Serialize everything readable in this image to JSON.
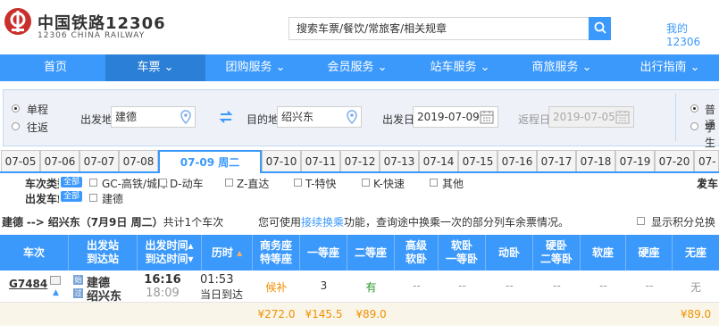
{
  "header": {
    "logo_cn": "中国铁路12306",
    "logo_en": "12306 CHINA RAILWAY",
    "search_placeholder": "搜索车票/餐饮/常旅客/相关规章",
    "my_link": "我的12306"
  },
  "nav": [
    "首页",
    "车票",
    "团购服务",
    "会员服务",
    "站车服务",
    "商旅服务",
    "出行指南"
  ],
  "query": {
    "trip_oneway": "单程",
    "trip_round": "往返",
    "from_label": "出发地",
    "from_value": "建德",
    "to_label": "目的地",
    "to_value": "绍兴东",
    "depart_label": "出发日",
    "depart_value": "2019-07-09",
    "return_label": "返程日",
    "return_value": "2019-07-05",
    "type_normal": "普通",
    "type_student": "学生"
  },
  "dates": [
    "07-05",
    "07-06",
    "07-07",
    "07-08",
    "07-09 周二",
    "07-10",
    "07-11",
    "07-12",
    "07-13",
    "07-14",
    "07-15",
    "07-16",
    "07-17",
    "07-18",
    "07-19",
    "07-20",
    "07-2"
  ],
  "filters": {
    "type_label": "车次类型",
    "all_label": "全部",
    "types": [
      "GC-高铁/城际",
      "D-动车",
      "Z-直达",
      "T-特快",
      "K-快速",
      "其他"
    ],
    "depart_time_label": "发车",
    "station_label": "出发车站",
    "stations": [
      "建德"
    ]
  },
  "summary": {
    "from": "建德",
    "arrow": "-->",
    "to": "绍兴东",
    "date": "（7月9日  周二）",
    "count_text": "共计1个车次",
    "tip_prefix": "您可使用",
    "tip_link": "接续换乘",
    "tip_suffix": "功能，查询途中换乘一次的部分列车余票情况。",
    "points_label": "显示积分兑换"
  },
  "table": {
    "headers": [
      [
        "车次"
      ],
      [
        "出发站",
        "到达站"
      ],
      [
        "出发时间",
        "到达时间"
      ],
      [
        "历时"
      ],
      [
        "商务座",
        "特等座"
      ],
      [
        "一等座"
      ],
      [
        "二等座"
      ],
      [
        "高级",
        "软卧"
      ],
      [
        "软卧",
        "一等卧"
      ],
      [
        "动卧"
      ],
      [
        "硬卧",
        "二等卧"
      ],
      [
        "软座"
      ],
      [
        "硬座"
      ],
      [
        "无座"
      ]
    ],
    "row": {
      "train": "G7484",
      "from_station": "建德",
      "to_station": "绍兴东",
      "depart_time": "16:16",
      "arrive_time": "18:09",
      "duration": "01:53",
      "arrive_day": "当日到达",
      "seats": [
        "候补",
        "3",
        "有",
        "--",
        "--",
        "--",
        "--",
        "--",
        "--",
        "无"
      ],
      "prices": [
        "¥272.0",
        "¥145.5",
        "¥89.0",
        "",
        "",
        "",
        "",
        "",
        "",
        "¥89.0"
      ]
    }
  },
  "colors": {
    "primary": "#3b99fc",
    "logo_red": "#c9302c",
    "orange": "#f08f00",
    "green": "#2a9a2a"
  }
}
